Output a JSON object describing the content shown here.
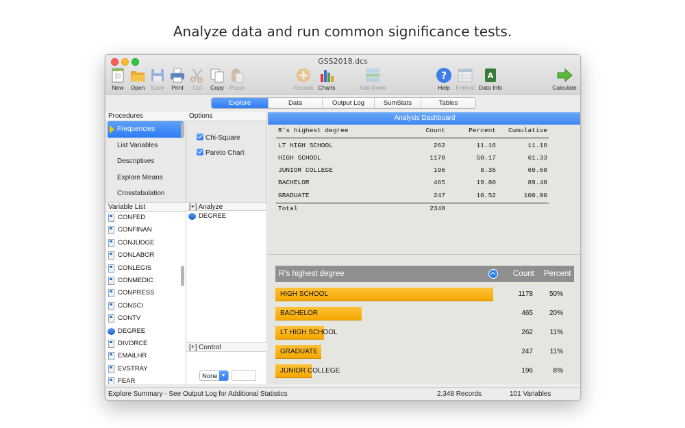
{
  "headline": "Analyze data and run common significance tests.",
  "window_title": "GSS2018.dcs",
  "toolbar": {
    "new": "New",
    "open": "Open",
    "save": "Save",
    "print": "Print",
    "cut": "Cut",
    "copy": "Copy",
    "paste": "Paste",
    "recode": "Recode",
    "charts": "Charts",
    "add_rows": "Add Rows",
    "help": "Help",
    "format": "Format",
    "data_info": "Data Info",
    "calculate": "Calculate"
  },
  "tabs": [
    "Explore",
    "Data",
    "Output Log",
    "SumStats",
    "Tables"
  ],
  "active_tab": "Explore",
  "procedures": {
    "header": "Procedures",
    "items": [
      "Frequencies",
      "List Variables",
      "Descriptives",
      "Explore Means",
      "Crosstabulation"
    ],
    "selected": "Frequencies"
  },
  "options": {
    "header": "Options",
    "chi_square": "Chi-Square",
    "pareto_chart": "Pareto Chart"
  },
  "variable_list": {
    "header": "Variable List",
    "items": [
      "CONFED",
      "CONFINAN",
      "CONJUDGE",
      "CONLABOR",
      "CONLEGIS",
      "CONMEDIC",
      "CONPRESS",
      "CONSCI",
      "CONTV",
      "DEGREE",
      "DIVORCE",
      "EMAILHR",
      "EVSTRAY",
      "FEAR"
    ]
  },
  "analyze": {
    "header": "[+] Analyze",
    "variable": "DEGREE"
  },
  "control": {
    "header": "[+] Control",
    "select_value": "None"
  },
  "dashboard": {
    "title": "Analysis Dashboard",
    "table": {
      "headers": [
        "R's highest degree",
        "Count",
        "Percent",
        "Cumulative"
      ],
      "rows": [
        [
          "LT HIGH SCHOOL",
          "262",
          "11.16",
          "11.16"
        ],
        [
          "HIGH SCHOOL",
          "1178",
          "50.17",
          "61.33"
        ],
        [
          "JUNIOR COLLEGE",
          "196",
          "8.35",
          "69.68"
        ],
        [
          "BACHELOR",
          "465",
          "19.80",
          "89.48"
        ],
        [
          "GRADUATE",
          "247",
          "10.52",
          "100.00"
        ]
      ],
      "total_label": "Total",
      "total_count": "2348"
    }
  },
  "chart_data": {
    "type": "bar",
    "title": "R's highest degree",
    "count_header": "Count",
    "percent_header": "Percent",
    "categories": [
      "HIGH SCHOOL",
      "BACHELOR",
      "LT HIGH SCHOOL",
      "GRADUATE",
      "JUNIOR COLLEGE"
    ],
    "values": [
      1178,
      465,
      262,
      247,
      196
    ],
    "percent_labels": [
      "50%",
      "20%",
      "11%",
      "11%",
      "8%"
    ],
    "orientation": "horizontal",
    "bar_color": "#f5a800"
  },
  "status": {
    "summary": "Explore Summary  -  See Output Log for Additional Statistics",
    "records": "2,348 Records",
    "variables": "101 Variables"
  }
}
